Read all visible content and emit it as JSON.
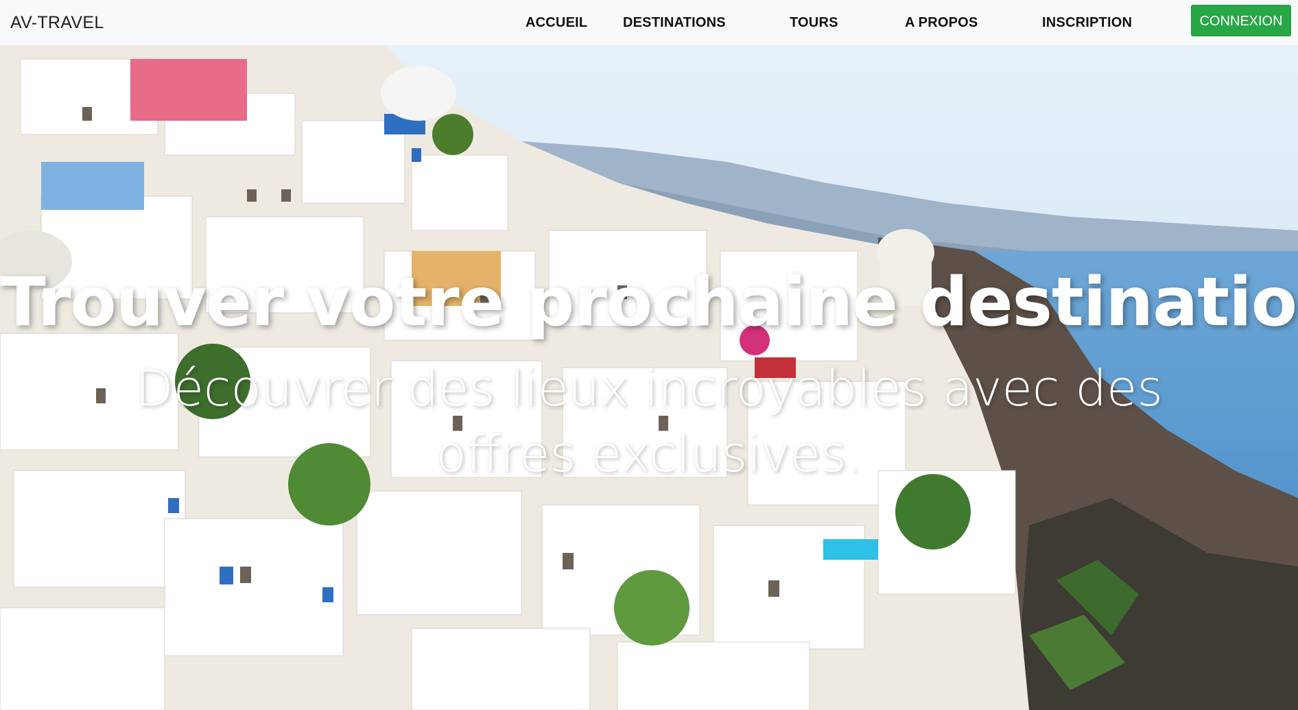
{
  "navbar": {
    "brand": "AV-TRAVEL",
    "links": [
      {
        "label": "ACCUEIL"
      },
      {
        "label": "DESTINATIONS"
      },
      {
        "label": "TOURS"
      },
      {
        "label": "A PROPOS"
      },
      {
        "label": "INSCRIPTION"
      }
    ],
    "login_button": "CONNEXION"
  },
  "hero": {
    "title": "Trouver votre prochaine destination.",
    "subtitle": "Découvrer des lieux incroyables avec des offres exclusives.",
    "image_subject": "whitewashed cliffside village above the sea"
  },
  "colors": {
    "navbar_bg": "#f8f9fa",
    "login_button_bg": "#28a745",
    "hero_text": "#ffffff"
  }
}
